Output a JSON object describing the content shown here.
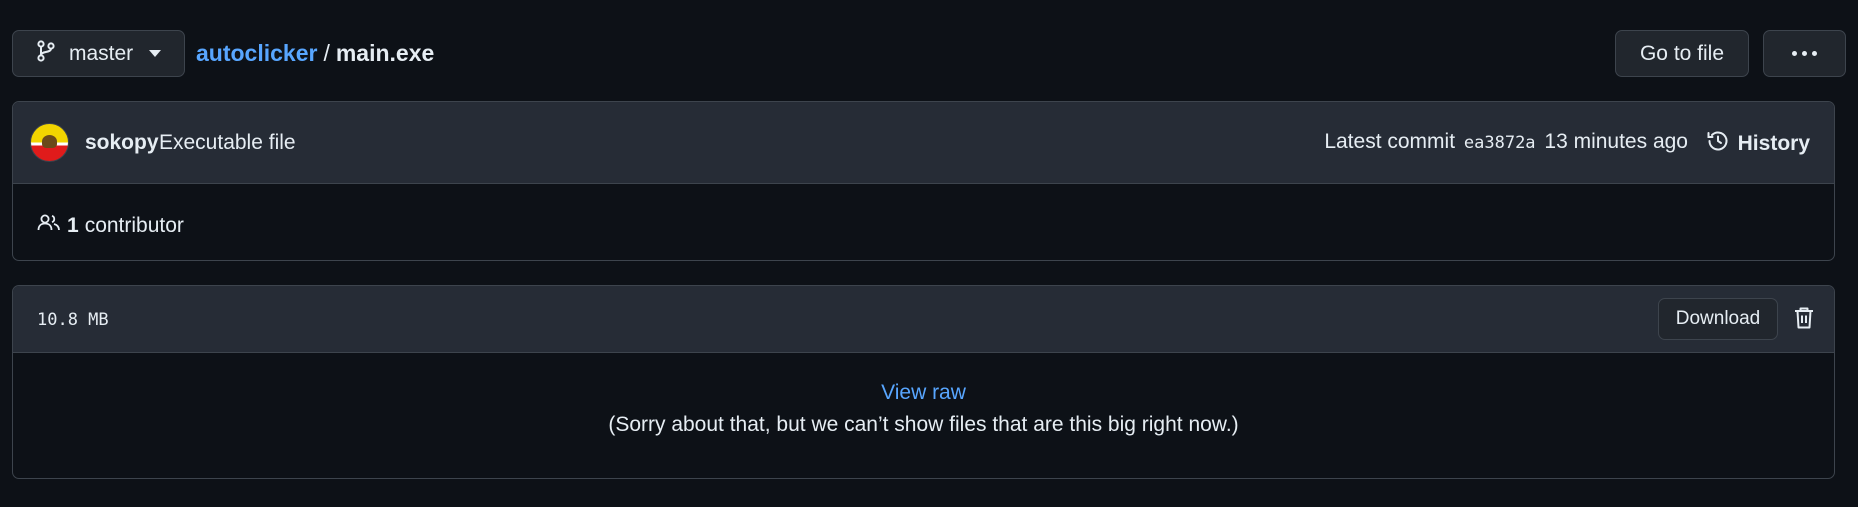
{
  "branch": {
    "label": "master",
    "icon": "git-branch-icon"
  },
  "breadcrumb": {
    "repo": "autoclicker",
    "separator": "/",
    "file": "main.exe"
  },
  "toolbar": {
    "goto_label": "Go to file",
    "more_icon": "kebab-horizontal-icon"
  },
  "commit": {
    "author": "sokopy",
    "message": "Executable file",
    "latest_label": "Latest commit",
    "sha": "ea3872a",
    "time": "13 minutes ago",
    "history_label": "History",
    "history_icon": "history-icon"
  },
  "contributors": {
    "count": "1",
    "label": "contributor",
    "icon": "people-icon"
  },
  "file": {
    "size": "10.8 MB",
    "download_label": "Download",
    "delete_icon": "trash-icon",
    "view_raw": "View raw",
    "message": "(Sorry about that, but we can’t show files that are this big right now.)"
  },
  "colors": {
    "background": "#0d1117",
    "header": "#262c36",
    "border": "#3d444d",
    "accent": "#58a6ff",
    "text": "#e6edf3"
  }
}
